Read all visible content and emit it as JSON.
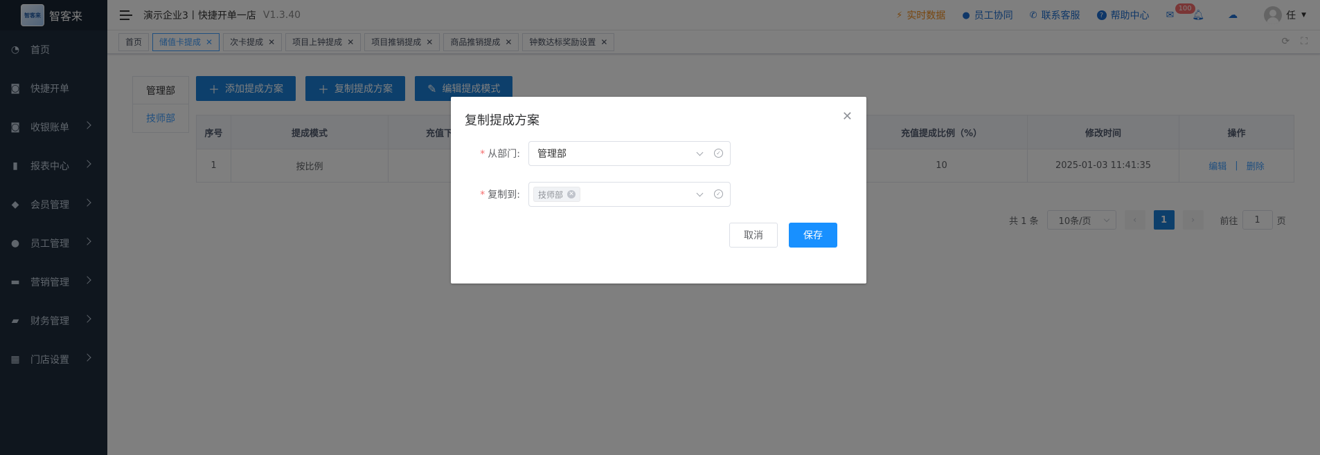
{
  "sidebar": {
    "brand": "智客来",
    "logo_text": "智客来",
    "items": [
      {
        "label": "首页",
        "icon": "dashboard-icon",
        "glyph": "◔",
        "arrow": false
      },
      {
        "label": "快捷开单",
        "icon": "bag-icon",
        "glyph": "◙",
        "arrow": false
      },
      {
        "label": "收银账单",
        "icon": "money-bag-icon",
        "glyph": "◙",
        "arrow": true
      },
      {
        "label": "报表中心",
        "icon": "bar-chart-icon",
        "glyph": "▮",
        "arrow": true
      },
      {
        "label": "会员管理",
        "icon": "diamond-icon",
        "glyph": "◆",
        "arrow": true
      },
      {
        "label": "员工管理",
        "icon": "user-icon",
        "glyph": "●",
        "arrow": true
      },
      {
        "label": "营销管理",
        "icon": "briefcase-icon",
        "glyph": "▬",
        "arrow": true
      },
      {
        "label": "财务管理",
        "icon": "wallet-icon",
        "glyph": "▰",
        "arrow": true
      },
      {
        "label": "门店设置",
        "icon": "grid-icon",
        "glyph": "▦",
        "arrow": true
      }
    ]
  },
  "header": {
    "title": "演示企业3丨快捷开单一店",
    "version": "V1.3.40",
    "links": [
      {
        "label": "实时数据",
        "icon": "pulse-icon",
        "glyph": "⚡"
      },
      {
        "label": "员工协同",
        "icon": "users-icon",
        "glyph": "👥"
      },
      {
        "label": "联系客服",
        "icon": "phone-icon",
        "glyph": "✆"
      },
      {
        "label": "帮助中心",
        "icon": "help-icon",
        "glyph": "?"
      }
    ],
    "mail_badge": "100",
    "user_name": "任"
  },
  "tags": [
    {
      "label": "首页",
      "closable": false,
      "active": false
    },
    {
      "label": "储值卡提成",
      "closable": true,
      "active": true
    },
    {
      "label": "次卡提成",
      "closable": true,
      "active": false
    },
    {
      "label": "项目上钟提成",
      "closable": true,
      "active": false
    },
    {
      "label": "项目推销提成",
      "closable": true,
      "active": false
    },
    {
      "label": "商品推销提成",
      "closable": true,
      "active": false
    },
    {
      "label": "钟数达标奖励设置",
      "closable": true,
      "active": false
    }
  ],
  "departments": [
    "管理部",
    "技师部"
  ],
  "buttons": {
    "add": "添加提成方案",
    "copy": "复制提成方案",
    "edit": "编辑提成模式"
  },
  "table": {
    "headers": [
      "序号",
      "提成模式",
      "充值下",
      "",
      "充值提成比例（%）",
      "修改时间",
      "操作"
    ],
    "rows": [
      {
        "index": "1",
        "mode": "按比例",
        "ratio": "10",
        "modified": "2025-01-03 11:41:35",
        "edit": "编辑",
        "sep": "|",
        "delete": "删除"
      }
    ]
  },
  "pager": {
    "total": "共 1 条",
    "page_size": "10条/页",
    "current": "1",
    "goto_prefix": "前往",
    "goto_value": "1",
    "goto_suffix": "页"
  },
  "dialog": {
    "title": "复制提成方案",
    "from_label": "从部门:",
    "from_value": "管理部",
    "to_label": "复制到:",
    "to_chip": "技师部",
    "cancel": "取消",
    "save": "保存"
  }
}
